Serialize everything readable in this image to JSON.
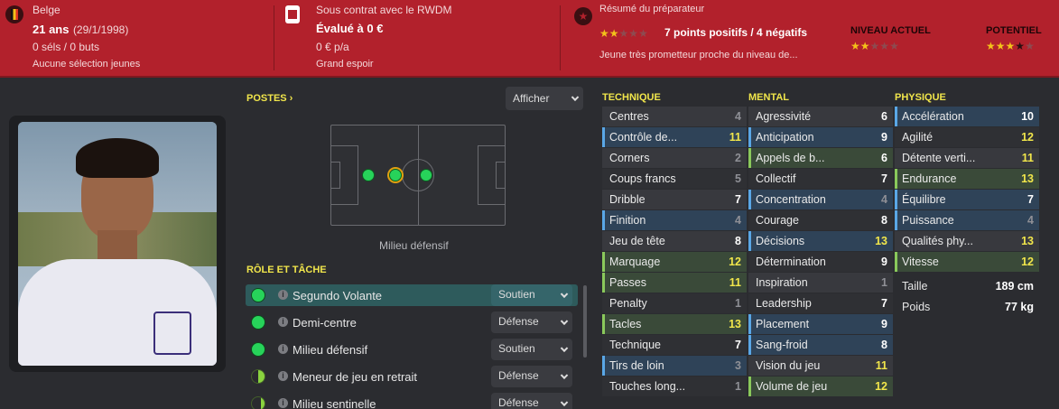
{
  "header": {
    "nationality": "Belge",
    "age": "21 ans",
    "dob": "(29/1/1998)",
    "caps": "0 séls / 0 buts",
    "youth": "Aucune sélection jeunes",
    "contract": "Sous contrat avec le RWDM",
    "value": "Évalué à 0 €",
    "wage": "0 € p/a",
    "prospect": "Grand espoir",
    "report_title": "Résumé du préparateur",
    "report_summary": "7 points positifs / 4 négatifs",
    "report_desc": "Jeune très prometteur proche du niveau de...",
    "current_label": "NIVEAU ACTUEL",
    "potential_label": "POTENTIEL",
    "report_stars": 2,
    "current_stars": 2,
    "potential_stars": 3.5
  },
  "positions": {
    "title": "POSTES ›",
    "show_button": "Afficher",
    "pitch_caption": "Milieu défensif"
  },
  "roles": {
    "title": "RÔLE ET TÂCHE",
    "items": [
      {
        "name": "Segundo Volante",
        "duty": "Soutien",
        "selected": true
      },
      {
        "name": "Demi-centre",
        "duty": "Défense"
      },
      {
        "name": "Milieu défensif",
        "duty": "Soutien"
      },
      {
        "name": "Meneur de jeu en retrait",
        "duty": "Défense"
      },
      {
        "name": "Milieu sentinelle",
        "duty": "Défense"
      }
    ]
  },
  "technique": {
    "title": "TECHNIQUE",
    "items": [
      {
        "name": "Centres",
        "value": "4"
      },
      {
        "name": "Contrôle de...",
        "value": "11"
      },
      {
        "name": "Corners",
        "value": "2"
      },
      {
        "name": "Coups francs",
        "value": "5"
      },
      {
        "name": "Dribble",
        "value": "7"
      },
      {
        "name": "Finition",
        "value": "4"
      },
      {
        "name": "Jeu de tête",
        "value": "8"
      },
      {
        "name": "Marquage",
        "value": "12"
      },
      {
        "name": "Passes",
        "value": "11"
      },
      {
        "name": "Penalty",
        "value": "1"
      },
      {
        "name": "Tacles",
        "value": "13"
      },
      {
        "name": "Technique",
        "value": "7"
      },
      {
        "name": "Tirs de loin",
        "value": "3"
      },
      {
        "name": "Touches long...",
        "value": "1"
      }
    ]
  },
  "mental": {
    "title": "MENTAL",
    "items": [
      {
        "name": "Agressivité",
        "value": "6"
      },
      {
        "name": "Anticipation",
        "value": "9"
      },
      {
        "name": "Appels de b...",
        "value": "6"
      },
      {
        "name": "Collectif",
        "value": "7"
      },
      {
        "name": "Concentration",
        "value": "4"
      },
      {
        "name": "Courage",
        "value": "8"
      },
      {
        "name": "Décisions",
        "value": "13"
      },
      {
        "name": "Détermination",
        "value": "9"
      },
      {
        "name": "Inspiration",
        "value": "1"
      },
      {
        "name": "Leadership",
        "value": "7"
      },
      {
        "name": "Placement",
        "value": "9"
      },
      {
        "name": "Sang-froid",
        "value": "8"
      },
      {
        "name": "Vision du jeu",
        "value": "11"
      },
      {
        "name": "Volume de jeu",
        "value": "12"
      }
    ]
  },
  "physique": {
    "title": "PHYSIQUE",
    "items": [
      {
        "name": "Accélération",
        "value": "10"
      },
      {
        "name": "Agilité",
        "value": "12"
      },
      {
        "name": "Détente verti...",
        "value": "11"
      },
      {
        "name": "Endurance",
        "value": "13"
      },
      {
        "name": "Équilibre",
        "value": "7"
      },
      {
        "name": "Puissance",
        "value": "4"
      },
      {
        "name": "Qualités phy...",
        "value": "13"
      },
      {
        "name": "Vitesse",
        "value": "12"
      }
    ],
    "height_label": "Taille",
    "height": "189 cm",
    "weight_label": "Poids",
    "weight": "77 kg"
  },
  "colors": {
    "header": "#b2212c",
    "accent": "#f1e64b",
    "stat_green": "#27d35a"
  }
}
